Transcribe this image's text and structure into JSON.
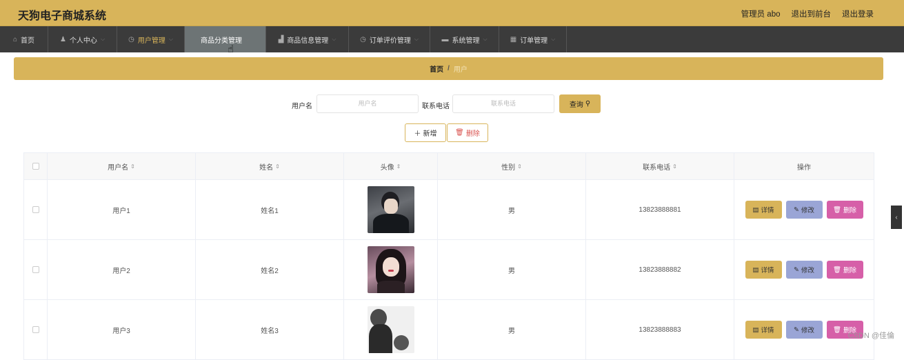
{
  "header": {
    "title": "天狗电子商城系统",
    "links": [
      "管理员 abo",
      "退出到前台",
      "退出登录"
    ]
  },
  "nav": [
    {
      "label": "首页",
      "icon": "⌂"
    },
    {
      "label": "个人中心",
      "icon": "♟"
    },
    {
      "label": "用户管理",
      "icon": "◷"
    },
    {
      "label": "商品分类管理",
      "icon": ""
    },
    {
      "label": "商品信息管理",
      "icon": "▟"
    },
    {
      "label": "订单评价管理",
      "icon": "◷"
    },
    {
      "label": "系统管理",
      "icon": "▬"
    },
    {
      "label": "订单管理",
      "icon": "▦"
    }
  ],
  "breadcrumb": {
    "home": "首页",
    "sep": "/",
    "current": "用户"
  },
  "search": {
    "username_label": "用户名",
    "username_placeholder": "用户名",
    "phone_label": "联系电话",
    "phone_placeholder": "联系电话",
    "query_label": "查询"
  },
  "actions": {
    "add_label": "新增",
    "delete_label": "删除"
  },
  "table": {
    "columns": [
      "用户名",
      "姓名",
      "头像",
      "性别",
      "联系电话",
      "操作"
    ],
    "rows": [
      {
        "username": "用户1",
        "name": "姓名1",
        "gender": "男",
        "phone": "13823888881"
      },
      {
        "username": "用户2",
        "name": "姓名2",
        "gender": "男",
        "phone": "13823888882"
      },
      {
        "username": "用户3",
        "name": "姓名3",
        "gender": "男",
        "phone": "13823888883"
      }
    ],
    "op_labels": {
      "detail": "详情",
      "edit": "修改",
      "delete": "删除"
    }
  },
  "watermark": "CSDN @佳倫",
  "colors": {
    "accent": "#d8b45a",
    "nav": "#3b3b3b",
    "edit": "#9aa5d6",
    "delete": "#d65fa8"
  }
}
